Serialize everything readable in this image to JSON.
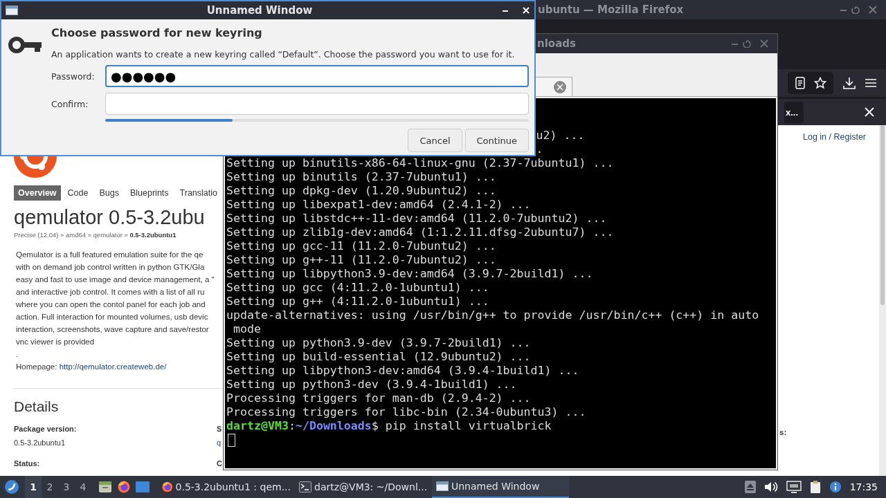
{
  "firefox_window": {
    "title": "ubuntu — Mozilla Firefox",
    "notification": {
      "button": "x..."
    },
    "page": {
      "nav": [
        {
          "label": "Overview",
          "selected": true
        },
        {
          "label": "Code",
          "selected": false
        },
        {
          "label": "Bugs",
          "selected": false
        },
        {
          "label": "Blueprints",
          "selected": false
        },
        {
          "label": "Translatio",
          "selected": false
        }
      ],
      "login": "Log in / Register",
      "heading": "qemulator 0.5-3.2ubu",
      "breadcrumb": "Precise (12.04) » amd64 » qemulator » **0.5-3.2ubuntu1**",
      "description": [
        "Qemulator is a full featured emulation suite for the qe",
        "with on demand job control written in python GTK/Gla",
        "easy and fast to use image and device management, a \"",
        "and interactive job control. It comes with a list of all ru",
        "where you can open the contol panel for each job and",
        "action. Full interaction for mounted volumes, usb devic",
        "interaction, screenshots, wave capture and save/restor",
        "vnc viewer is provided",
        "."
      ],
      "homepage_label": "Homepage:",
      "homepage_link": "http://qemulator.createweb.de/",
      "details_heading": "Details",
      "details": [
        {
          "label": "Package version:",
          "value": "0.5-3.2ubuntu1"
        },
        {
          "label": "Status:"
        }
      ],
      "details_column_2": [
        {
          "label": "S",
          "value": "q"
        },
        {
          "label": "C"
        }
      ],
      "details_column_3": [
        {
          "label": "s:"
        }
      ]
    }
  },
  "terminal_window": {
    "title": "nloads",
    "lines": [
      {
        "kind": "partial",
        "text": "u2) ..."
      },
      {
        "kind": "partial",
        "text": "."
      },
      {
        "kind": "output",
        "text": "Setting up binutils-x86-64-linux-gnu (2.37-7ubuntu1) ..."
      },
      {
        "kind": "output",
        "text": "Setting up binutils (2.37-7ubuntu1) ..."
      },
      {
        "kind": "output",
        "text": "Setting up dpkg-dev (1.20.9ubuntu2) ..."
      },
      {
        "kind": "output",
        "text": "Setting up libexpat1-dev:amd64 (2.4.1-2) ..."
      },
      {
        "kind": "output",
        "text": "Setting up libstdc++-11-dev:amd64 (11.2.0-7ubuntu2) ..."
      },
      {
        "kind": "output",
        "text": "Setting up zlib1g-dev:amd64 (1:1.2.11.dfsg-2ubuntu7) ..."
      },
      {
        "kind": "output",
        "text": "Setting up gcc-11 (11.2.0-7ubuntu2) ..."
      },
      {
        "kind": "output",
        "text": "Setting up g++-11 (11.2.0-7ubuntu2) ..."
      },
      {
        "kind": "output",
        "text": "Setting up libpython3.9-dev:amd64 (3.9.7-2build1) ..."
      },
      {
        "kind": "output",
        "text": "Setting up gcc (4:11.2.0-1ubuntu1) ..."
      },
      {
        "kind": "output",
        "text": "Setting up g++ (4:11.2.0-1ubuntu1) ..."
      },
      {
        "kind": "output",
        "text": "update-alternatives: using /usr/bin/g++ to provide /usr/bin/c++ (c++) in auto"
      },
      {
        "kind": "output",
        "text": " mode"
      },
      {
        "kind": "output",
        "text": "Setting up python3.9-dev (3.9.7-2build1) ..."
      },
      {
        "kind": "output",
        "text": "Setting up build-essential (12.9ubuntu2) ..."
      },
      {
        "kind": "output",
        "text": "Setting up libpython3-dev:amd64 (3.9.4-1build1) ..."
      },
      {
        "kind": "output",
        "text": "Setting up python3-dev (3.9.4-1build1) ..."
      },
      {
        "kind": "output",
        "text": "Processing triggers for man-db (2.9.4-2) ..."
      },
      {
        "kind": "output",
        "text": "Processing triggers for libc-bin (2.34-0ubuntu3) ..."
      }
    ],
    "prompt": {
      "user": "dartz@VM3",
      "separator": ":",
      "path": "~/Downloads",
      "command": "$ pip install virtualbrick"
    }
  },
  "dialog": {
    "title": "Unnamed Window",
    "heading": "Choose password for new keyring",
    "message": "An application wants to create a new keyring called “Default”. Choose the password you want to use for it.",
    "fields": [
      {
        "label": "Password:",
        "value": "●●●●●●",
        "focused": true
      },
      {
        "label": "Confirm:",
        "focused": false
      }
    ],
    "strength": {
      "level": 0.3
    },
    "buttons": [
      "Cancel",
      "Continue"
    ]
  },
  "taskbar": {
    "workspaces": [
      {
        "label": "1",
        "selected": true
      },
      {
        "label": "2",
        "selected": false
      },
      {
        "label": "3",
        "selected": false
      },
      {
        "label": "4",
        "selected": false
      }
    ],
    "tasks": [
      {
        "kind": "browser",
        "label": "0.5-3.2ubuntu1 : qem...",
        "selected": false
      },
      {
        "kind": "terminal",
        "label": "dartz@VM3: ~/Downl...",
        "selected": false
      },
      {
        "kind": "window",
        "label": "Unnamed Window",
        "selected": true
      }
    ],
    "clock": "17:35"
  }
}
